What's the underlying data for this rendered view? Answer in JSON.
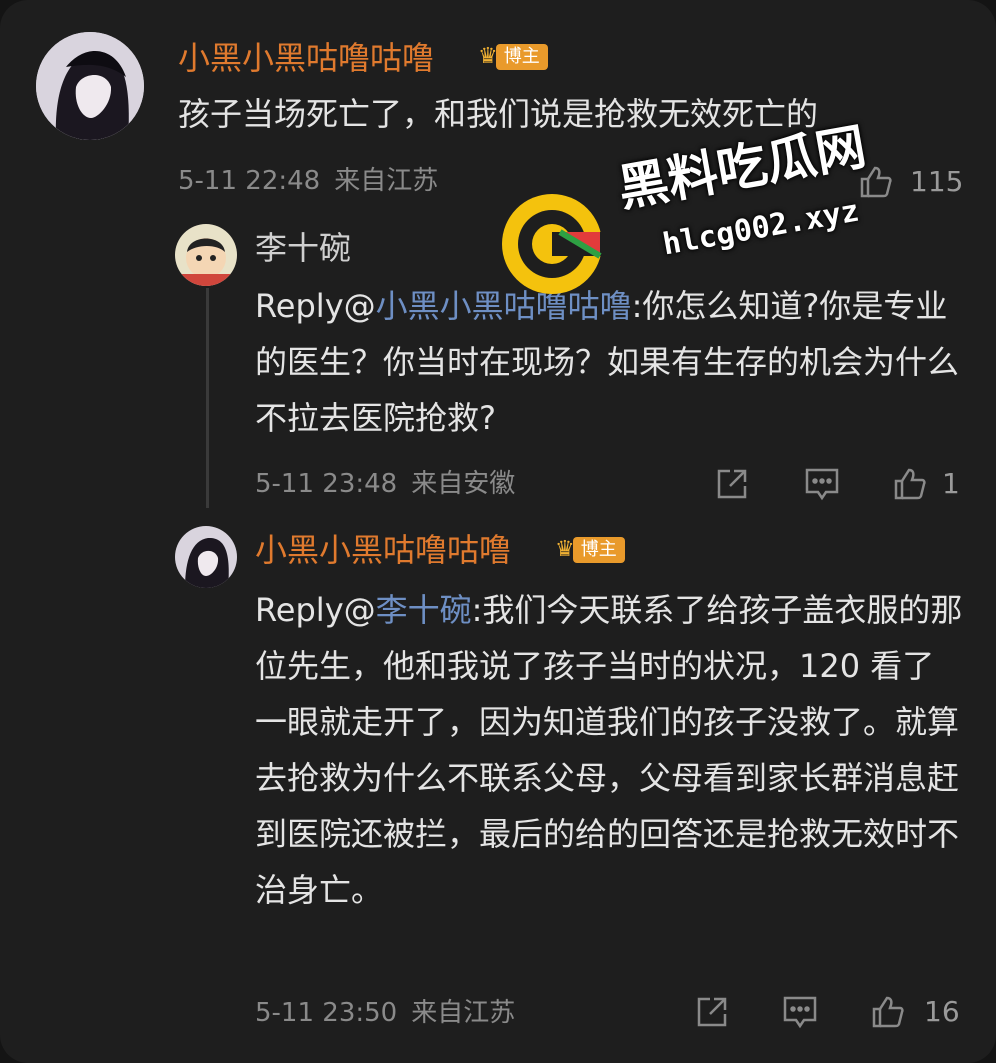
{
  "comments": [
    {
      "name": "小黑小黑咕噜咕噜",
      "badge": "博主",
      "text": "孩子当场死亡了，和我们说是抢救无效死亡的",
      "time": "5-11 22:48",
      "location": "来自江苏",
      "likes": "115"
    },
    {
      "name": "李十碗",
      "reply_prefix": "Reply@",
      "mention": "小黑小黑咕噜咕噜",
      "text": ":你怎么知道?你是专业的医生？你当时在现场？如果有生存的机会为什么不拉去医院抢救?",
      "time": "5-11 23:48",
      "location": "来自安徽",
      "likes": "1"
    },
    {
      "name": "小黑小黑咕噜咕噜",
      "badge": "博主",
      "reply_prefix": "Reply@",
      "mention": "李十碗",
      "text": ":我们今天联系了给孩子盖衣服的那位先生，他和我说了孩子当时的状况，120 看了一眼就走开了，因为知道我们的孩子没救了。就算去抢救为什么不联系父母，父母看到家长群消息赶到医院还被拦，最后的给的回答还是抢救无效时不治身亡。",
      "time": "5-11 23:50",
      "location": "来自江苏",
      "likes": "16"
    }
  ],
  "watermark": {
    "title": "黑料吃瓜网",
    "url": "hlcg002.xyz"
  },
  "colors": {
    "background": "#1e1e1e",
    "username": "#e07a2e",
    "mention": "#6e8fc4",
    "text": "#e4e4e4",
    "meta": "#8a8a8a",
    "badge": "#e99a2b"
  }
}
